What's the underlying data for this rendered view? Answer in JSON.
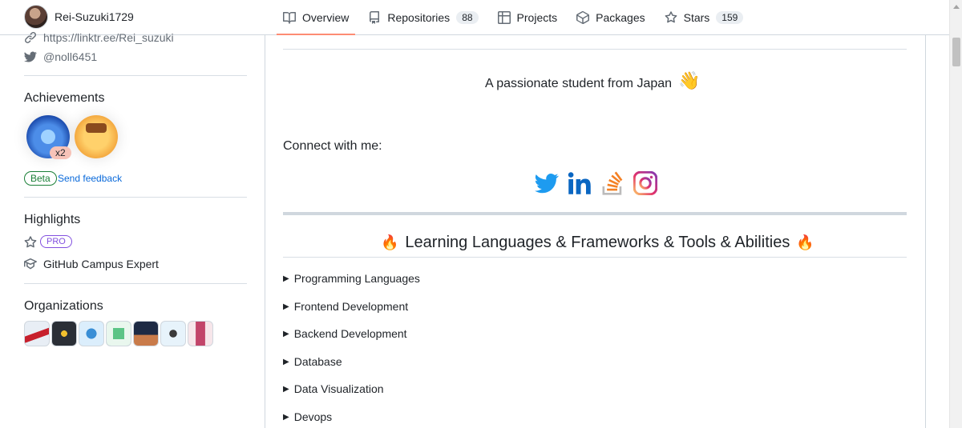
{
  "header": {
    "username": "Rei-Suzuki1729",
    "tabs": [
      {
        "label": "Overview",
        "icon": "book-icon",
        "active": true
      },
      {
        "label": "Repositories",
        "icon": "repo-icon",
        "count": "88"
      },
      {
        "label": "Projects",
        "icon": "table-icon"
      },
      {
        "label": "Packages",
        "icon": "package-icon"
      },
      {
        "label": "Stars",
        "icon": "star-icon",
        "count": "159"
      }
    ]
  },
  "sidebar": {
    "link": "https://linktr.ee/Rei_suzuki",
    "twitter": "@noll6451",
    "achievements": {
      "heading": "Achievements",
      "multiplier": "x2",
      "beta_label": "Beta",
      "feedback_label": "Send feedback"
    },
    "highlights": {
      "heading": "Highlights",
      "pro_label": "PRO",
      "campus": "GitHub Campus Expert"
    },
    "organizations": {
      "heading": "Organizations",
      "colors": [
        "#e8eef5",
        "#2b2f36",
        "#dbeefc",
        "#e9f7ee",
        "#1e2a44",
        "#e7f3fb",
        "#f7e6ea"
      ]
    }
  },
  "main": {
    "tagline": "A passionate student from Japan",
    "connect": "Connect with me:",
    "socials": [
      "twitter",
      "linkedin",
      "stackoverflow",
      "instagram"
    ],
    "section_title": "Learning Languages & Frameworks & Tools & Abilities",
    "details": [
      "Programming Languages",
      "Frontend Development",
      "Backend Development",
      "Database",
      "Data Visualization",
      "Devops"
    ]
  },
  "colors": {
    "accent_underline": "#fd8c73",
    "link_blue": "#0969da",
    "beta_green": "#1a7f37",
    "pro_purple": "#8250df",
    "twitter_blue": "#1d9bf0",
    "linkedin_blue": "#0a66c2",
    "stackoverflow_orange": "#f48024"
  }
}
